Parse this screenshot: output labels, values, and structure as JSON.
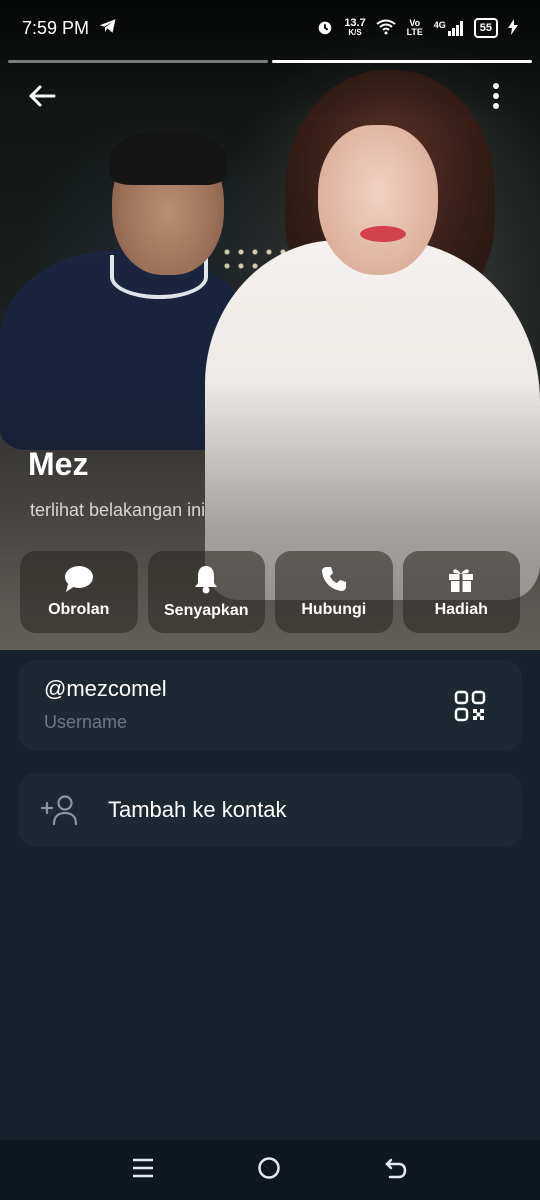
{
  "status_bar": {
    "time": "7:59 PM",
    "network_speed": "13.7",
    "network_speed_unit": "K/S",
    "volte": "Vo LTE",
    "network_type": "4G",
    "battery": "55"
  },
  "profile": {
    "name": "Mez",
    "last_seen": "terlihat belakangan ini"
  },
  "actions": [
    {
      "label": "Obrolan",
      "icon": "chat-bubble-icon"
    },
    {
      "label": "Senyapkan",
      "icon": "bell-icon"
    },
    {
      "label": "Hubungi",
      "icon": "phone-icon"
    },
    {
      "label": "Hadiah",
      "icon": "gift-icon"
    }
  ],
  "username_card": {
    "value": "@mezcomel",
    "label": "Username",
    "icon": "qr-code-icon"
  },
  "add_contact": {
    "label": "Tambah ke kontak",
    "icon": "add-person-icon"
  },
  "colors": {
    "background": "#17212b",
    "card": "#1e2833",
    "muted_text": "#6c7883",
    "navbar": "#0f1821"
  }
}
